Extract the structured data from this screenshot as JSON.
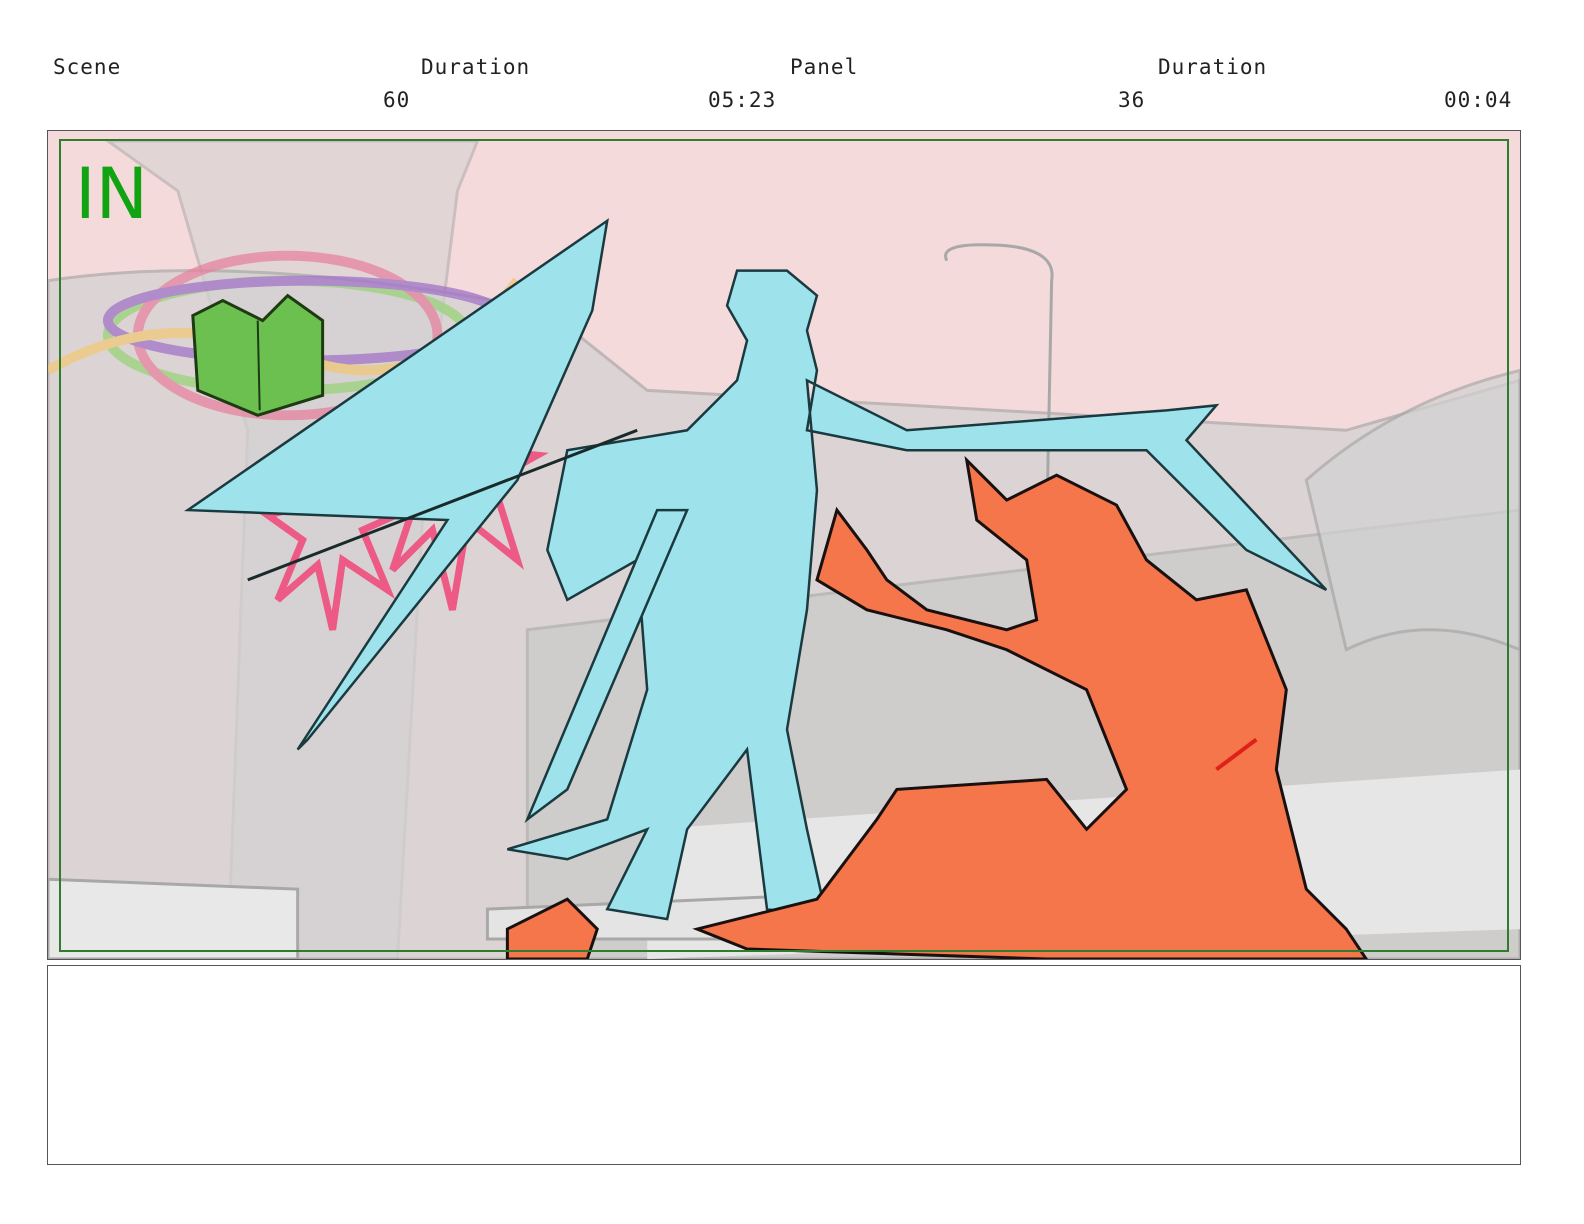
{
  "header": {
    "scene_label": "Scene",
    "scene_duration_label": "Duration",
    "panel_label": "Panel",
    "panel_duration_label": "Duration",
    "scene_value": "60",
    "scene_duration_value": "05:23",
    "panel_value": "36",
    "panel_duration_value": "00:04"
  },
  "panel": {
    "transition_label": "IN",
    "marker_color": "#12a312",
    "sky_color": "#f4dadb",
    "figure_left_color": "#9ee3ec",
    "figure_right_color": "#f4764a",
    "magic_symbol_color": "#ee5a86",
    "book_color": "#6cc04f"
  },
  "notes": {
    "text": ""
  }
}
